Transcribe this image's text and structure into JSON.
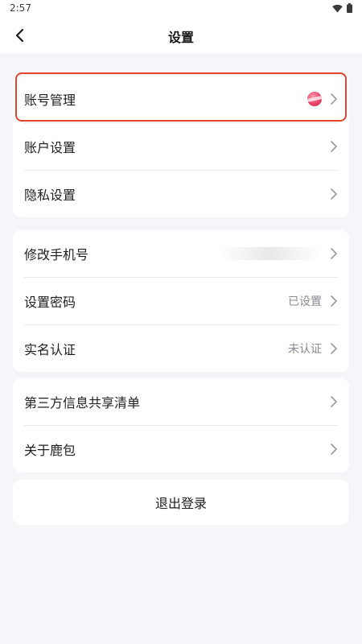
{
  "status_bar": {
    "time": "2:57",
    "icons": [
      "wifi-icon",
      "battery-icon"
    ]
  },
  "nav": {
    "title": "设置",
    "back_icon": "chevron-left-icon"
  },
  "groups": [
    {
      "items": [
        {
          "label": "账号管理",
          "value": "",
          "has_avatar": true,
          "highlighted": true
        },
        {
          "label": "账户设置",
          "value": ""
        },
        {
          "label": "隐私设置",
          "value": ""
        }
      ]
    },
    {
      "items": [
        {
          "label": "修改手机号",
          "value": "",
          "obscured_value": true
        },
        {
          "label": "设置密码",
          "value": "已设置"
        },
        {
          "label": "实名认证",
          "value": "未认证"
        }
      ]
    },
    {
      "items": [
        {
          "label": "第三方信息共享清单",
          "value": ""
        },
        {
          "label": "关于鹿包",
          "value": ""
        }
      ]
    }
  ],
  "logout": {
    "label": "退出登录"
  },
  "colors": {
    "background": "#f5f6fa",
    "card": "#ffffff",
    "highlight_border": "#e0452d",
    "secondary_text": "#8a8a92",
    "chevron": "#9a9aa2"
  }
}
